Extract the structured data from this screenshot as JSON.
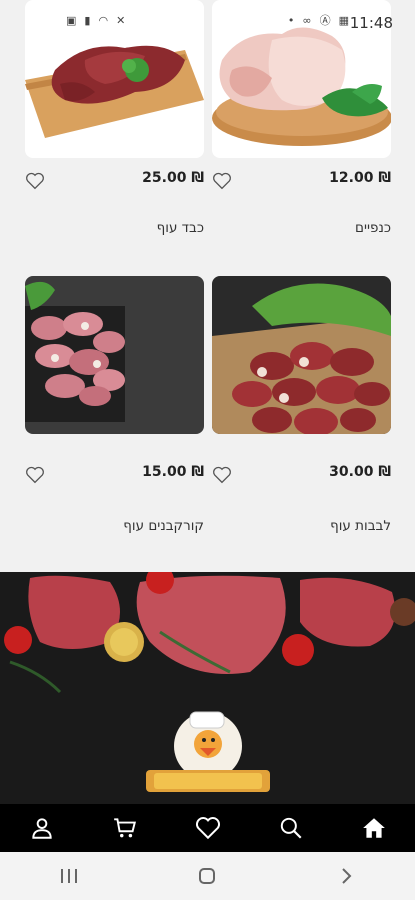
{
  "status_bar": {
    "time": "11:48"
  },
  "products": [
    {
      "name": "כנפיים",
      "price": "12.00 ₪",
      "photo_icon": "chicken-wings-photo"
    },
    {
      "name": "כבד עוף",
      "price": "25.00 ₪",
      "photo_icon": "chicken-liver-photo"
    },
    {
      "name": "לבבות עוף",
      "price": "30.00 ₪",
      "photo_icon": "chicken-hearts-photo"
    },
    {
      "name": "קורקבנים עוף",
      "price": "15.00 ₪",
      "photo_icon": "chicken-gizzards-photo"
    }
  ],
  "bottom_nav": {
    "items": [
      "profile-icon",
      "cart-icon",
      "heart-icon",
      "search-icon",
      "home-icon"
    ]
  },
  "colors": {
    "nav_bg": "#000000",
    "page_bg": "#f1f1f1",
    "text": "#222222"
  }
}
